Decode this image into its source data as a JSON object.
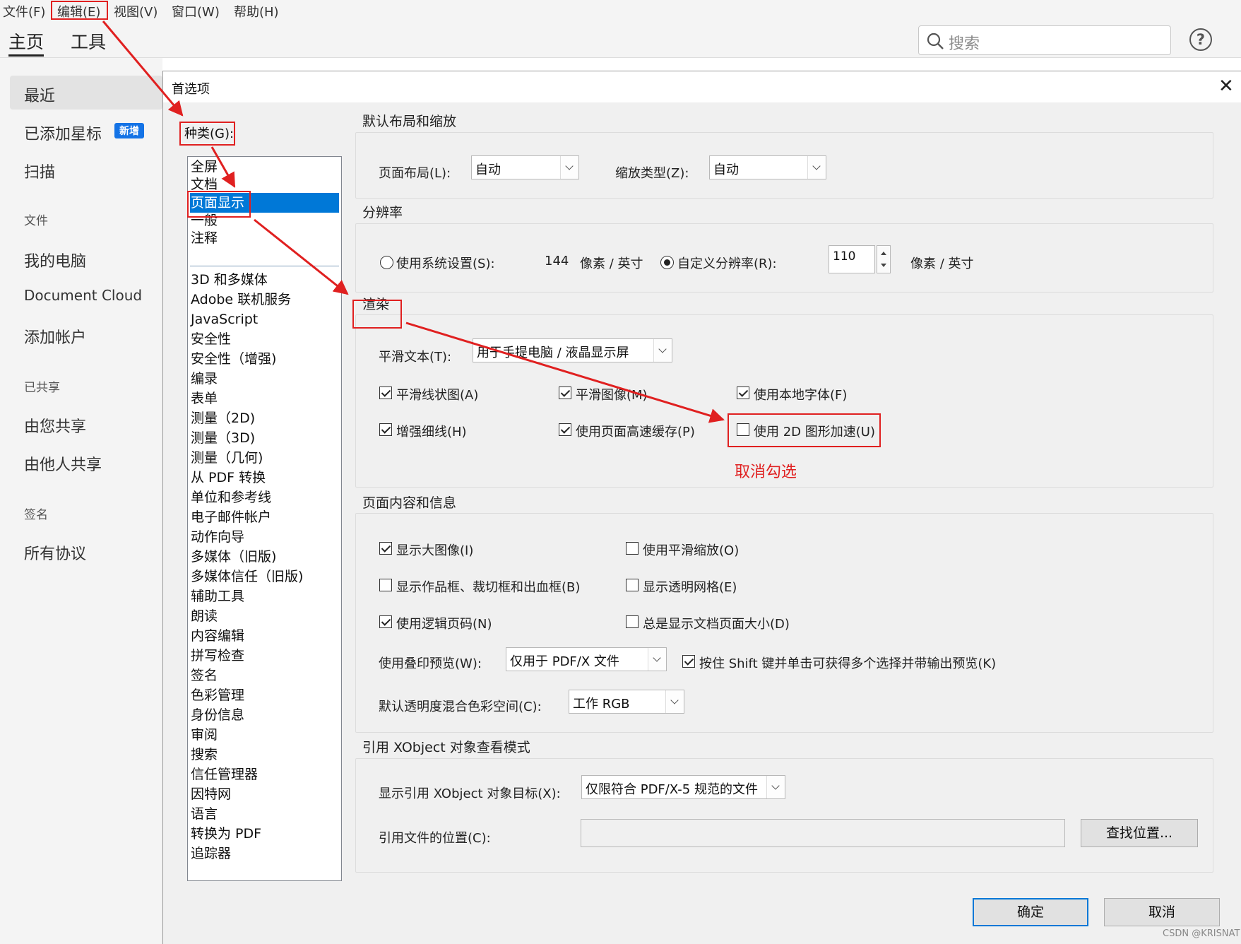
{
  "menubar": [
    "文件(F)",
    "编辑(E)",
    "视图(V)",
    "窗口(W)",
    "帮助(H)"
  ],
  "toolbar": {
    "tab_home": "主页",
    "tab_tools": "工具",
    "search_placeholder": "搜索",
    "help": "?"
  },
  "sidebar": {
    "recent": "最近",
    "starred": "已添加星标",
    "new_badge": "新增",
    "scan": "扫描",
    "files_head": "文件",
    "my_computer": "我的电脑",
    "document_cloud": "Document Cloud",
    "add_account": "添加帐户",
    "shared_head": "已共享",
    "shared_by_you": "由您共享",
    "shared_by_others": "由他人共享",
    "sign_head": "签名",
    "all_agreements": "所有协议"
  },
  "dialog": {
    "title": "首选项",
    "close": "✕",
    "category_label": "种类(G):",
    "categories_top": [
      "全屏",
      "文档",
      "页面显示",
      "一般",
      "注释"
    ],
    "categories": [
      "3D 和多媒体",
      "Adobe 联机服务",
      "JavaScript",
      "安全性",
      "安全性（增强)",
      "编录",
      "表单",
      "测量（2D)",
      "测量（3D)",
      "测量（几何)",
      "从 PDF 转换",
      "单位和参考线",
      "电子邮件帐户",
      "动作向导",
      "多媒体（旧版)",
      "多媒体信任（旧版)",
      "辅助工具",
      "朗读",
      "内容编辑",
      "拼写检查",
      "签名",
      "色彩管理",
      "身份信息",
      "审阅",
      "搜索",
      "信任管理器",
      "因特网",
      "语言",
      "转换为 PDF",
      "追踪器"
    ],
    "selected_category": "页面显示",
    "layout": {
      "title": "默认布局和缩放",
      "page_layout_label": "页面布局(L):",
      "page_layout_value": "自动",
      "zoom_label": "缩放类型(Z):",
      "zoom_value": "自动"
    },
    "resolution": {
      "title": "分辨率",
      "system_label": "使用系统设置(S):",
      "system_value": "144",
      "unit1": "像素 / 英寸",
      "custom_label": "自定义分辨率(R):",
      "custom_value": "110",
      "unit2": "像素 / 英寸",
      "selected": "custom"
    },
    "render": {
      "title": "渲染",
      "smooth_text_label": "平滑文本(T):",
      "smooth_text_value": "用于手提电脑 / 液晶显示屏",
      "cb_smooth_line": "平滑线状图(A)",
      "cb_smooth_image": "平滑图像(M)",
      "cb_local_fonts": "使用本地字体(F)",
      "cb_enhance_thin": "增强细线(H)",
      "cb_page_cache": "使用页面高速缓存(P)",
      "cb_2d_accel": "使用 2D 图形加速(U)",
      "annotation": "取消勾选"
    },
    "content": {
      "title": "页面内容和信息",
      "cb_large_images": "显示大图像(I)",
      "cb_smooth_zoom": "使用平滑缩放(O)",
      "cb_art_trim": "显示作品框、裁切框和出血框(B)",
      "cb_transparency_grid": "显示透明网格(E)",
      "cb_logical_page": "使用逻辑页码(N)",
      "cb_page_size": "总是显示文档页面大小(D)",
      "overprint_label": "使用叠印预览(W):",
      "overprint_value": "仅用于 PDF/X 文件",
      "cb_shift_click": "按住 Shift 键并单击可获得多个选择并带输出预览(K)",
      "blend_label": "默认透明度混合色彩空间(C):",
      "blend_value": "工作 RGB"
    },
    "xobject": {
      "title": "引用 XObject 对象查看模式",
      "show_label": "显示引用 XObject 对象目标(X):",
      "show_value": "仅限符合 PDF/X-5 规范的文件",
      "location_label": "引用文件的位置(C):",
      "location_value": "",
      "browse_button": "查找位置..."
    },
    "ok_button": "确定",
    "cancel_button": "取消"
  },
  "watermark": "CSDN @KRISNAT",
  "colors": {
    "annotation_red": "#e02020",
    "selection_blue": "#0078d7",
    "badge_blue": "#1473e6"
  }
}
